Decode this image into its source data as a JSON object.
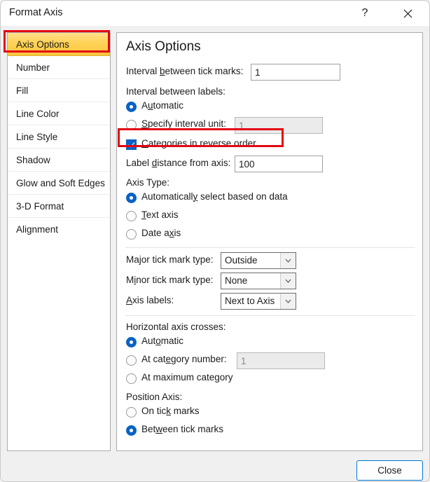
{
  "window": {
    "title": "Format Axis",
    "help_icon": "question-mark-icon",
    "close_icon": "close-x-icon"
  },
  "sidebar": {
    "items": [
      {
        "label": "Axis Options",
        "selected": true
      },
      {
        "label": "Number",
        "selected": false
      },
      {
        "label": "Fill",
        "selected": false
      },
      {
        "label": "Line Color",
        "selected": false
      },
      {
        "label": "Line Style",
        "selected": false
      },
      {
        "label": "Shadow",
        "selected": false
      },
      {
        "label": "Glow and Soft Edges",
        "selected": false
      },
      {
        "label": "3-D Format",
        "selected": false
      },
      {
        "label": "Alignment",
        "selected": false
      }
    ]
  },
  "panel": {
    "title": "Axis Options",
    "interval_tick_marks": {
      "label_pre": "Interval ",
      "label_accel": "b",
      "label_post": "etween tick marks:",
      "value": "1"
    },
    "interval_labels": {
      "group_label": "Interval between labels:",
      "automatic": {
        "pre": "A",
        "accel": "u",
        "post": "tomatic",
        "checked": true
      },
      "specify": {
        "pre": "",
        "accel": "S",
        "post": "pecify interval unit:",
        "checked": false,
        "value": "1",
        "disabled": true
      }
    },
    "reverse_order": {
      "pre": "",
      "accel": "C",
      "post": "ategories in reverse order",
      "checked": true
    },
    "label_distance": {
      "label_pre": "Label ",
      "label_accel": "d",
      "label_post": "istance from axis:",
      "value": "100"
    },
    "axis_type": {
      "group_label": "Axis Type:",
      "options": [
        {
          "pre": "Automaticall",
          "accel": "y",
          "post": " select based on data",
          "checked": true
        },
        {
          "pre": "",
          "accel": "T",
          "post": "ext axis",
          "checked": false
        },
        {
          "pre": "Date a",
          "accel": "x",
          "post": "is",
          "checked": false
        }
      ]
    },
    "tick_marks": [
      {
        "label_pre": "Ma",
        "label_accel": "j",
        "label_post": "or tick mark type:",
        "value": "Outside"
      },
      {
        "label_pre": "M",
        "label_accel": "i",
        "label_post": "nor tick mark type:",
        "value": "None"
      },
      {
        "label_pre": "",
        "label_accel": "A",
        "label_post": "xis labels:",
        "value": "Next to Axis"
      }
    ],
    "horizontal_crosses": {
      "group_label": "Horizontal axis crosses:",
      "options": [
        {
          "pre": "Aut",
          "accel": "o",
          "post": "matic",
          "checked": true
        },
        {
          "pre": "At cat",
          "accel": "e",
          "post": "gory number:",
          "checked": false,
          "value": "1",
          "disabled": true
        },
        {
          "pre": "At maximum cate",
          "accel": "g",
          "post": "ory",
          "checked": false
        }
      ]
    },
    "position_axis": {
      "group_label": "Position Axis:",
      "options": [
        {
          "pre": "On tic",
          "accel": "k",
          "post": " marks",
          "checked": false
        },
        {
          "pre": "Bet",
          "accel": "w",
          "post": "een tick marks",
          "checked": true
        }
      ]
    }
  },
  "footer": {
    "close_label": "Close"
  },
  "colors": {
    "accent": "#0b62c4",
    "highlight_red": "#e30613",
    "selected_yellow": "#ffd257",
    "default_button_border": "#0078d4"
  }
}
